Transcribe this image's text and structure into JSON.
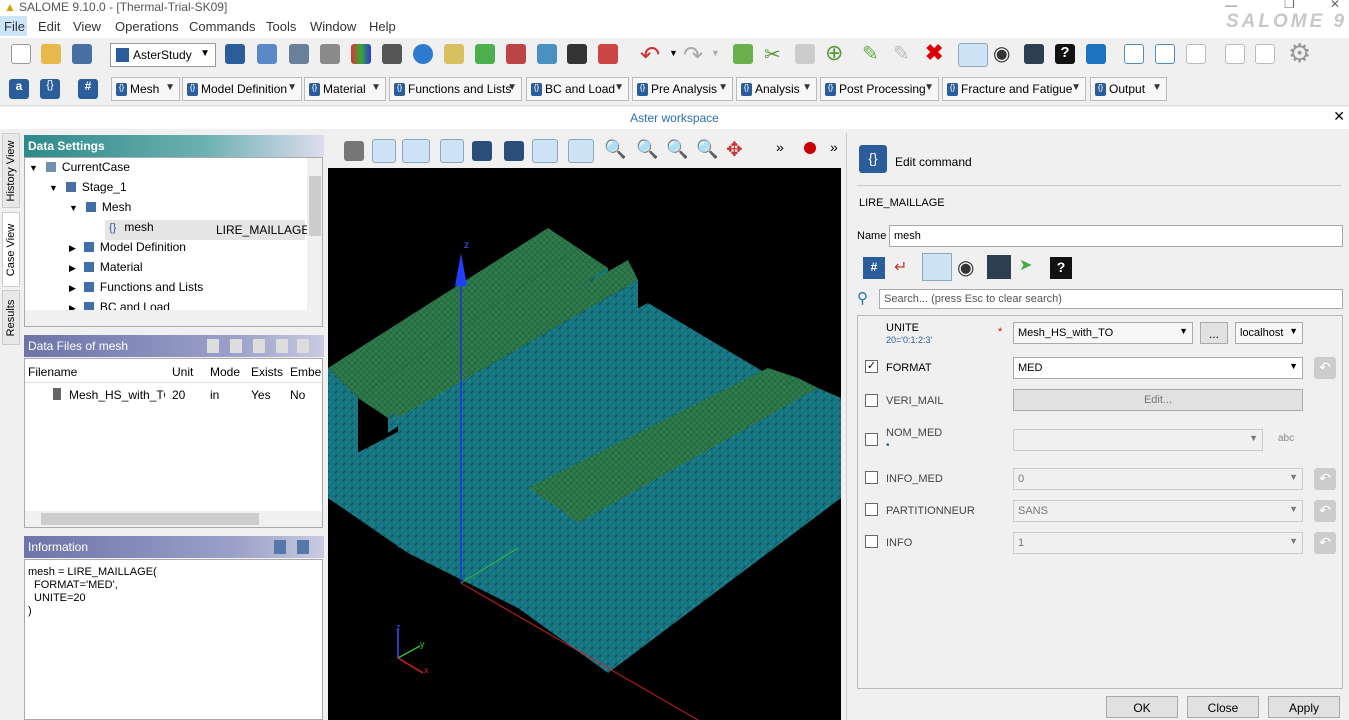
{
  "window": {
    "title": "SALOME 9.10.0 - [Thermal-Trial-SK09]",
    "brand": "SALOME 9"
  },
  "menu": [
    "File",
    "Edit",
    "View",
    "Operations",
    "Commands",
    "Tools",
    "Window",
    "Help"
  ],
  "module_selector": "AsterStudy",
  "command_groups": [
    "Mesh",
    "Model Definition",
    "Material",
    "Functions and Lists",
    "BC and Load",
    "Pre Analysis",
    "Analysis",
    "Post Processing",
    "Fracture and Fatigue",
    "Output"
  ],
  "workspace_label": "Aster workspace",
  "side_tabs": [
    "History View",
    "Case View",
    "Results"
  ],
  "data_settings": {
    "title": "Data Settings",
    "tree": [
      {
        "label": "CurrentCase",
        "depth": 0
      },
      {
        "label": "Stage_1",
        "depth": 1
      },
      {
        "label": "Mesh",
        "depth": 2
      },
      {
        "label": "mesh",
        "depth": 3,
        "value": "LIRE_MAILLAGE"
      },
      {
        "label": "Model Definition",
        "depth": 2
      },
      {
        "label": "Material",
        "depth": 2
      },
      {
        "label": "Functions and Lists",
        "depth": 2
      },
      {
        "label": "BC and Load",
        "depth": 2
      }
    ]
  },
  "data_files": {
    "title": "Data Files of mesh",
    "columns": [
      "Filename",
      "Unit",
      "Mode",
      "Exists",
      "Embe"
    ],
    "rows": [
      [
        "Mesh_HS_with_TO",
        "20",
        "in",
        "Yes",
        "No"
      ]
    ]
  },
  "information": {
    "title": "Information",
    "lines": [
      "mesh = LIRE_MAILLAGE(",
      "FORMAT='MED',",
      "UNITE=20",
      ")"
    ]
  },
  "axes": {
    "z": "z",
    "x": "x",
    "y": "y"
  },
  "editor": {
    "title": "Edit command",
    "command": "LIRE_MAILLAGE",
    "name_label": "Name",
    "name_value": "mesh",
    "search_placeholder": "Search... (press Esc to clear search)",
    "unite": {
      "label": "UNITE",
      "sub": "20='0:1:2:3'",
      "value": "Mesh_HS_with_TO",
      "more": "...",
      "host": "localhost"
    },
    "params": [
      {
        "label": "FORMAT",
        "value": "MED",
        "checked": true
      },
      {
        "label": "VERI_MAIL",
        "value": "Edit...",
        "checked": false
      },
      {
        "label": "NOM_MED",
        "value": "",
        "checked": false
      },
      {
        "label": "INFO_MED",
        "value": "0",
        "checked": false
      },
      {
        "label": "PARTITIONNEUR",
        "value": "SANS",
        "checked": false
      },
      {
        "label": "INFO",
        "value": "1",
        "checked": false
      }
    ],
    "abc": "abc",
    "buttons": [
      "OK",
      "Close",
      "Apply"
    ]
  }
}
